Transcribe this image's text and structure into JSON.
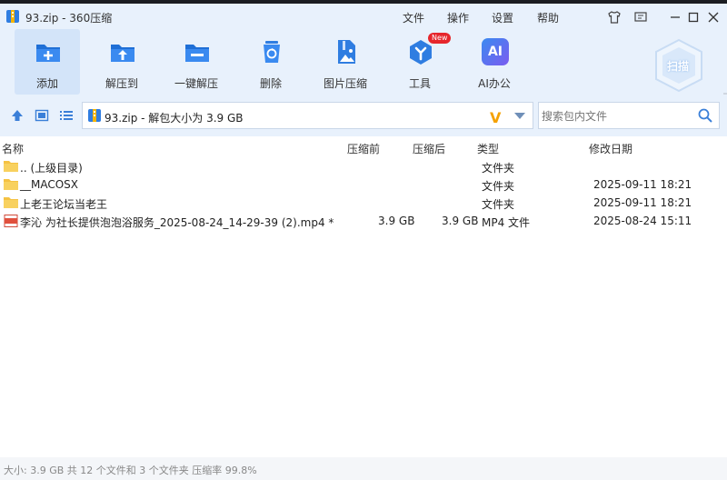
{
  "window": {
    "title": "93.zip - 360压缩"
  },
  "menu": {
    "file": "文件",
    "operate": "操作",
    "settings": "设置",
    "help": "帮助"
  },
  "toolbar": {
    "add": "添加",
    "extract_to": "解压到",
    "one_click": "一键解压",
    "delete": "删除",
    "image_compress": "图片压缩",
    "tools": "工具",
    "tools_badge": "New",
    "ai_office": "AI办公",
    "ai_icon_text": "AI",
    "scan": "扫描"
  },
  "address": {
    "path": "93.zip - 解包大小为 3.9 GB",
    "logo_letter": "V"
  },
  "search": {
    "placeholder": "搜索包内文件"
  },
  "columns": {
    "name": "名称",
    "compressed": "压缩前",
    "after": "压缩后",
    "type": "类型",
    "modified": "修改日期"
  },
  "files": [
    {
      "name": ".. (上级目录)",
      "before": "",
      "after": "",
      "type": "文件夹",
      "date": "",
      "kind": "folder"
    },
    {
      "name": "__MACOSX",
      "before": "",
      "after": "",
      "type": "文件夹",
      "date": "2025-09-11 18:21",
      "kind": "folder"
    },
    {
      "name": "上老王论坛当老王",
      "before": "",
      "after": "",
      "type": "文件夹",
      "date": "2025-09-11 18:21",
      "kind": "folder"
    },
    {
      "name": "李沁 为社长提供泡泡浴服务_2025-08-24_14-29-39 (2).mp4 *",
      "before": "3.9 GB",
      "after": "3.9 GB",
      "type": "MP4 文件",
      "date": "2025-08-24 15:11",
      "kind": "mp4"
    }
  ],
  "status": {
    "text": "大小: 3.9 GB 共 12 个文件和 3 个文件夹 压缩率 99.8%"
  }
}
